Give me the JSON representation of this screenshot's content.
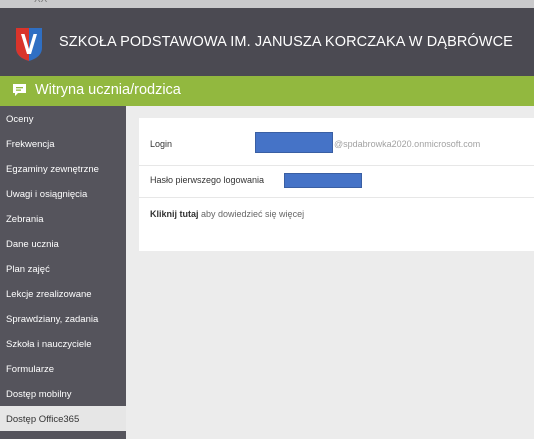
{
  "topstrip": {
    "ghost_text": "XX"
  },
  "header": {
    "school_name": "SZKOŁA PODSTAWOWA IM. JANUSZA KORCZAKA W DĄBRÓWCE"
  },
  "section": {
    "title": "Witryna ucznia/rodzica"
  },
  "sidebar": {
    "items": [
      {
        "label": "Oceny"
      },
      {
        "label": "Frekwencja"
      },
      {
        "label": "Egzaminy zewnętrzne"
      },
      {
        "label": "Uwagi i osiągnięcia"
      },
      {
        "label": "Zebrania"
      },
      {
        "label": "Dane ucznia"
      },
      {
        "label": "Plan zajęć"
      },
      {
        "label": "Lekcje zrealizowane"
      },
      {
        "label": "Sprawdziany, zadania"
      },
      {
        "label": "Szkoła i nauczyciele"
      },
      {
        "label": "Formularze"
      },
      {
        "label": "Dostęp mobilny"
      },
      {
        "label": "Dostęp Office365"
      }
    ]
  },
  "office365": {
    "login_label": "Login",
    "login_domain": "@spdabrowka2020.onmicrosoft.com",
    "password_label": "Hasło pierwszego logowania",
    "more_link": "Kliknij tutaj",
    "more_text": " aby dowiedzieć się więcej"
  },
  "colors": {
    "header": "#4b4a52",
    "accent_green": "#92b83f",
    "sidebar": "#55545c",
    "redaction": "#4573c7"
  }
}
